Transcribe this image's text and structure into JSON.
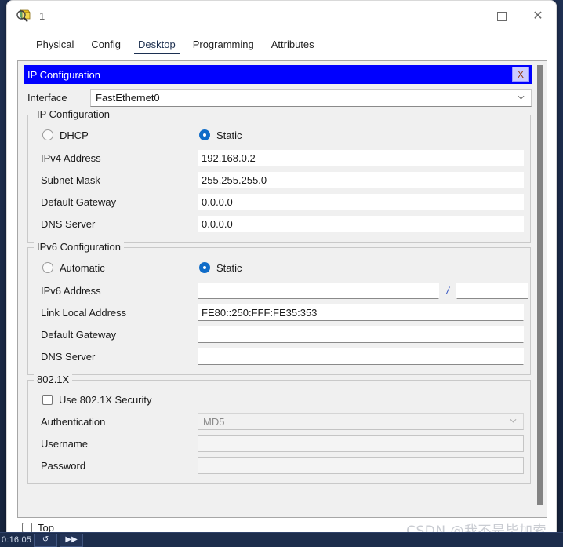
{
  "window": {
    "title": "1",
    "icon": "packet-tracer-magnifier-icon",
    "controls": {
      "minimize": "minimize",
      "maximize": "maximize",
      "close": "close"
    }
  },
  "tabs": [
    {
      "label": "Physical",
      "active": false
    },
    {
      "label": "Config",
      "active": false
    },
    {
      "label": "Desktop",
      "active": true
    },
    {
      "label": "Programming",
      "active": false
    },
    {
      "label": "Attributes",
      "active": false
    }
  ],
  "dialog": {
    "title": "IP Configuration",
    "close_label": "X",
    "title_bg": "#0000ff",
    "interface": {
      "label": "Interface",
      "value": "FastEthernet0"
    },
    "ipv4": {
      "legend": "IP Configuration",
      "mode": {
        "dhcp_label": "DHCP",
        "static_label": "Static",
        "selected": "Static"
      },
      "fields": [
        {
          "label": "IPv4 Address",
          "value": "192.168.0.2"
        },
        {
          "label": "Subnet Mask",
          "value": "255.255.255.0"
        },
        {
          "label": "Default Gateway",
          "value": "0.0.0.0"
        },
        {
          "label": "DNS Server",
          "value": "0.0.0.0"
        }
      ]
    },
    "ipv6": {
      "legend": "IPv6 Configuration",
      "mode": {
        "automatic_label": "Automatic",
        "static_label": "Static",
        "selected": "Static"
      },
      "address": {
        "label": "IPv6 Address",
        "value": "",
        "separator": "/",
        "prefix": ""
      },
      "fields": [
        {
          "label": "Link Local Address",
          "value": "FE80::250:FFF:FE35:353"
        },
        {
          "label": "Default Gateway",
          "value": ""
        },
        {
          "label": "DNS Server",
          "value": ""
        }
      ]
    },
    "dot1x": {
      "legend": "802.1X",
      "use_security_label": "Use 802.1X Security",
      "use_security_checked": false,
      "authentication": {
        "label": "Authentication",
        "value": "MD5"
      },
      "username": {
        "label": "Username",
        "value": ""
      },
      "password": {
        "label": "Password",
        "value": ""
      }
    }
  },
  "bottom": {
    "top_label": "Top",
    "top_checked": false
  },
  "watermark": "CSDN @我不是毕加索",
  "taskbar": {
    "clock": "0:16:05",
    "buttons": [
      "↺",
      "▶▶"
    ]
  }
}
